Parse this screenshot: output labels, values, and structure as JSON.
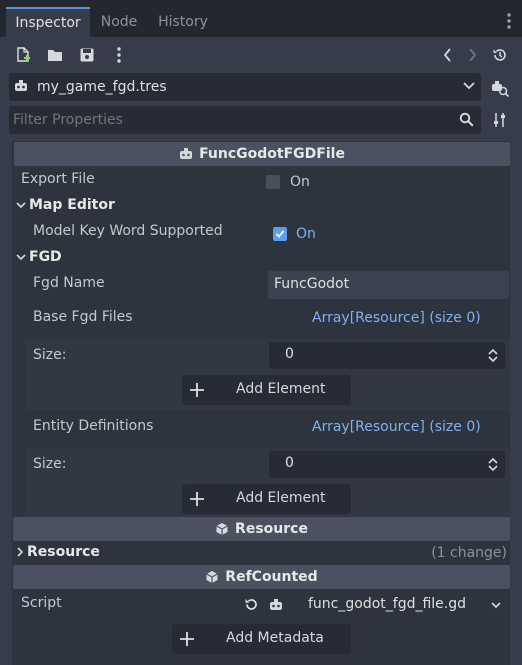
{
  "tabs": [
    {
      "label": "Inspector"
    },
    {
      "label": "Node"
    },
    {
      "label": "History"
    }
  ],
  "resource_selector": {
    "value": "my_game_fgd.tres"
  },
  "filter": {
    "placeholder": "Filter Properties"
  },
  "inspector": {
    "class_header": "FuncGodotFGDFile",
    "export_file": {
      "label": "Export File",
      "value": "On",
      "checked": false
    },
    "map_editor_section": "Map Editor",
    "model_key_word": {
      "label": "Model Key Word Supported",
      "value": "On",
      "checked": true
    },
    "fgd_section": "FGD",
    "fgd_name": {
      "label": "Fgd Name",
      "value": "FuncGodot"
    },
    "base_fgd_files": {
      "label": "Base Fgd Files",
      "value": "Array[Resource] (size 0)",
      "size_label": "Size:",
      "size_value": "0",
      "add_label": "Add Element"
    },
    "entity_definitions": {
      "label": "Entity Definitions",
      "value": "Array[Resource] (size 0)",
      "size_label": "Size:",
      "size_value": "0",
      "add_label": "Add Element"
    },
    "resource_header": "Resource",
    "resource_section": {
      "label": "Resource",
      "changes": "(1 change)"
    },
    "refcounted_header": "RefCounted",
    "script": {
      "label": "Script",
      "value": "func_godot_fgd_file.gd"
    },
    "add_metadata": "Add Metadata"
  },
  "colors": {
    "accent": "#5c8ee6",
    "link": "#7fb0f2",
    "checkbox_on": "#5c9ef0",
    "background": "#363d4a"
  }
}
